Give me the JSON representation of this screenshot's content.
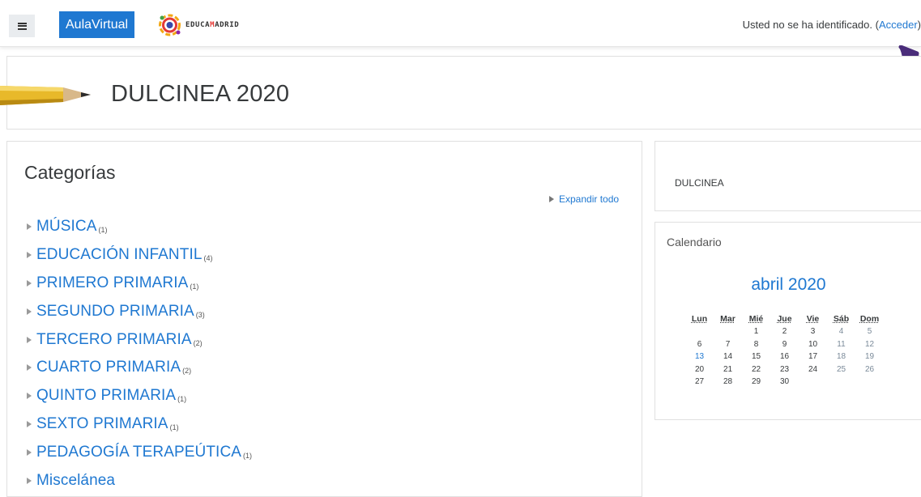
{
  "navbar": {
    "brand_button": "AulaVirtual",
    "logo_text_prefix": "E",
    "logo_text_mid": "DUCA",
    "logo_text_red": "M",
    "logo_text_suffix": "ADRID",
    "login_text": "Usted no se ha identificado. (",
    "login_link": "Acceder",
    "login_close": ")"
  },
  "course": {
    "title": "DULCINEA 2020"
  },
  "categories": {
    "heading": "Categorías",
    "expand_all": "Expandir todo",
    "items": [
      {
        "name": "MÚSICA",
        "count": "(1)"
      },
      {
        "name": "EDUCACIÓN INFANTIL",
        "count": "(4)"
      },
      {
        "name": "PRIMERO PRIMARIA",
        "count": "(1)"
      },
      {
        "name": "SEGUNDO PRIMARIA",
        "count": "(3)"
      },
      {
        "name": "TERCERO PRIMARIA",
        "count": "(2)"
      },
      {
        "name": "CUARTO PRIMARIA",
        "count": "(2)"
      },
      {
        "name": "QUINTO PRIMARIA",
        "count": "(1)"
      },
      {
        "name": "SEXTO PRIMARIA",
        "count": "(1)"
      },
      {
        "name": "PEDAGOGÍA TERAPEÚTICA",
        "count": "(1)"
      },
      {
        "name": "Miscelánea",
        "count": ""
      }
    ]
  },
  "blocks": {
    "dulcinea_text": "DULCINEA",
    "calendar_title": "Calendario",
    "calendar_month": "abril 2020",
    "weekdays": [
      "Lun",
      "Mar",
      "Mié",
      "Jue",
      "Vie",
      "Sáb",
      "Dom"
    ],
    "weeks": [
      [
        "",
        "",
        "1",
        "2",
        "3",
        "4",
        "5"
      ],
      [
        "6",
        "7",
        "8",
        "9",
        "10",
        "11",
        "12"
      ],
      [
        "13",
        "14",
        "15",
        "16",
        "17",
        "18",
        "19"
      ],
      [
        "20",
        "21",
        "22",
        "23",
        "24",
        "25",
        "26"
      ],
      [
        "27",
        "28",
        "29",
        "30",
        "",
        "",
        ""
      ]
    ]
  },
  "colors": {
    "link": "#1f78d1",
    "brand": "#1f78d1",
    "text": "#373a3c",
    "weekend": "#7a8a99",
    "arrow": "#4a2d7a"
  },
  "icons": {
    "menu": "hamburger-icon",
    "logo": "educamadrid-logo-icon",
    "course_image": "pencil-icon",
    "expand": "triangle-right-icon",
    "pointer": "arrow-icon"
  }
}
